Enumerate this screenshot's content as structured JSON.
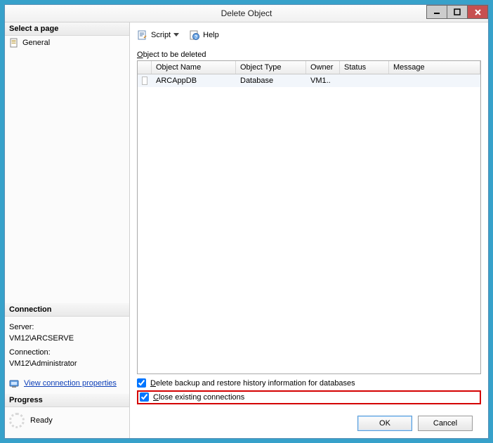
{
  "title": "Delete Object",
  "left": {
    "select_page_header": "Select a page",
    "general_label": "General",
    "connection_header": "Connection",
    "server_label": "Server:",
    "server_value": "VM12\\ARCSERVE",
    "connection_label": "Connection:",
    "connection_value": "VM12\\Administrator",
    "view_props": "View connection properties",
    "progress_header": "Progress",
    "progress_status": "Ready"
  },
  "toolbar": {
    "script_label": "Script",
    "help_label": "Help"
  },
  "list_label": "Object to be deleted",
  "columns": {
    "name": "Object Name",
    "type": "Object Type",
    "owner": "Owner",
    "status": "Status",
    "message": "Message"
  },
  "row": {
    "name": "ARCAppDB",
    "type": "Database",
    "owner": "VM1..",
    "status": "",
    "message": ""
  },
  "options": {
    "delete_history": "Delete backup and restore history information for databases",
    "close_connections": "Close existing connections"
  },
  "buttons": {
    "ok": "OK",
    "cancel": "Cancel"
  }
}
